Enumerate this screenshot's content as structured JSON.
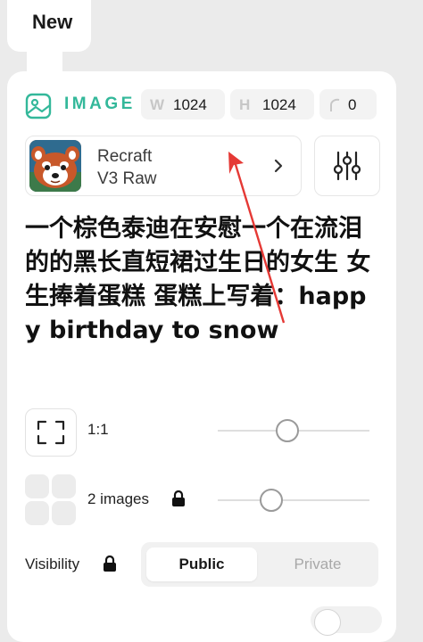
{
  "tab": {
    "new_label": "New"
  },
  "header": {
    "mode_label": "IMAGE",
    "width_letter": "W",
    "width_value": "1024",
    "height_letter": "H",
    "height_value": "1024",
    "seed_value": "0",
    "mode_icon": "image-icon",
    "accent_color": "#33b89a"
  },
  "model": {
    "name_line1": "Recraft",
    "name_line2": "V3 Raw",
    "thumbnail": "red-panda-avatar",
    "chevron_icon": "chevron-right-icon",
    "settings_icon": "sliders-icon"
  },
  "prompt": {
    "text": "一个棕色泰迪在安慰一个在流泪的的黑长直短裙过生日的女生 女生捧着蛋糕 蛋糕上写着：happy birthday to snow"
  },
  "aspect": {
    "label": "1:1",
    "icon": "expand-corners-icon",
    "slider_level": 0.46
  },
  "count": {
    "label": "2 images",
    "icon": "grid-icon",
    "lock_icon": "lock-icon",
    "slider_level": 0.35
  },
  "visibility": {
    "label": "Visibility",
    "lock_icon": "lock-icon",
    "options": [
      "Public",
      "Private"
    ],
    "selected": "Public"
  },
  "annotation": {
    "color": "#e53935"
  }
}
